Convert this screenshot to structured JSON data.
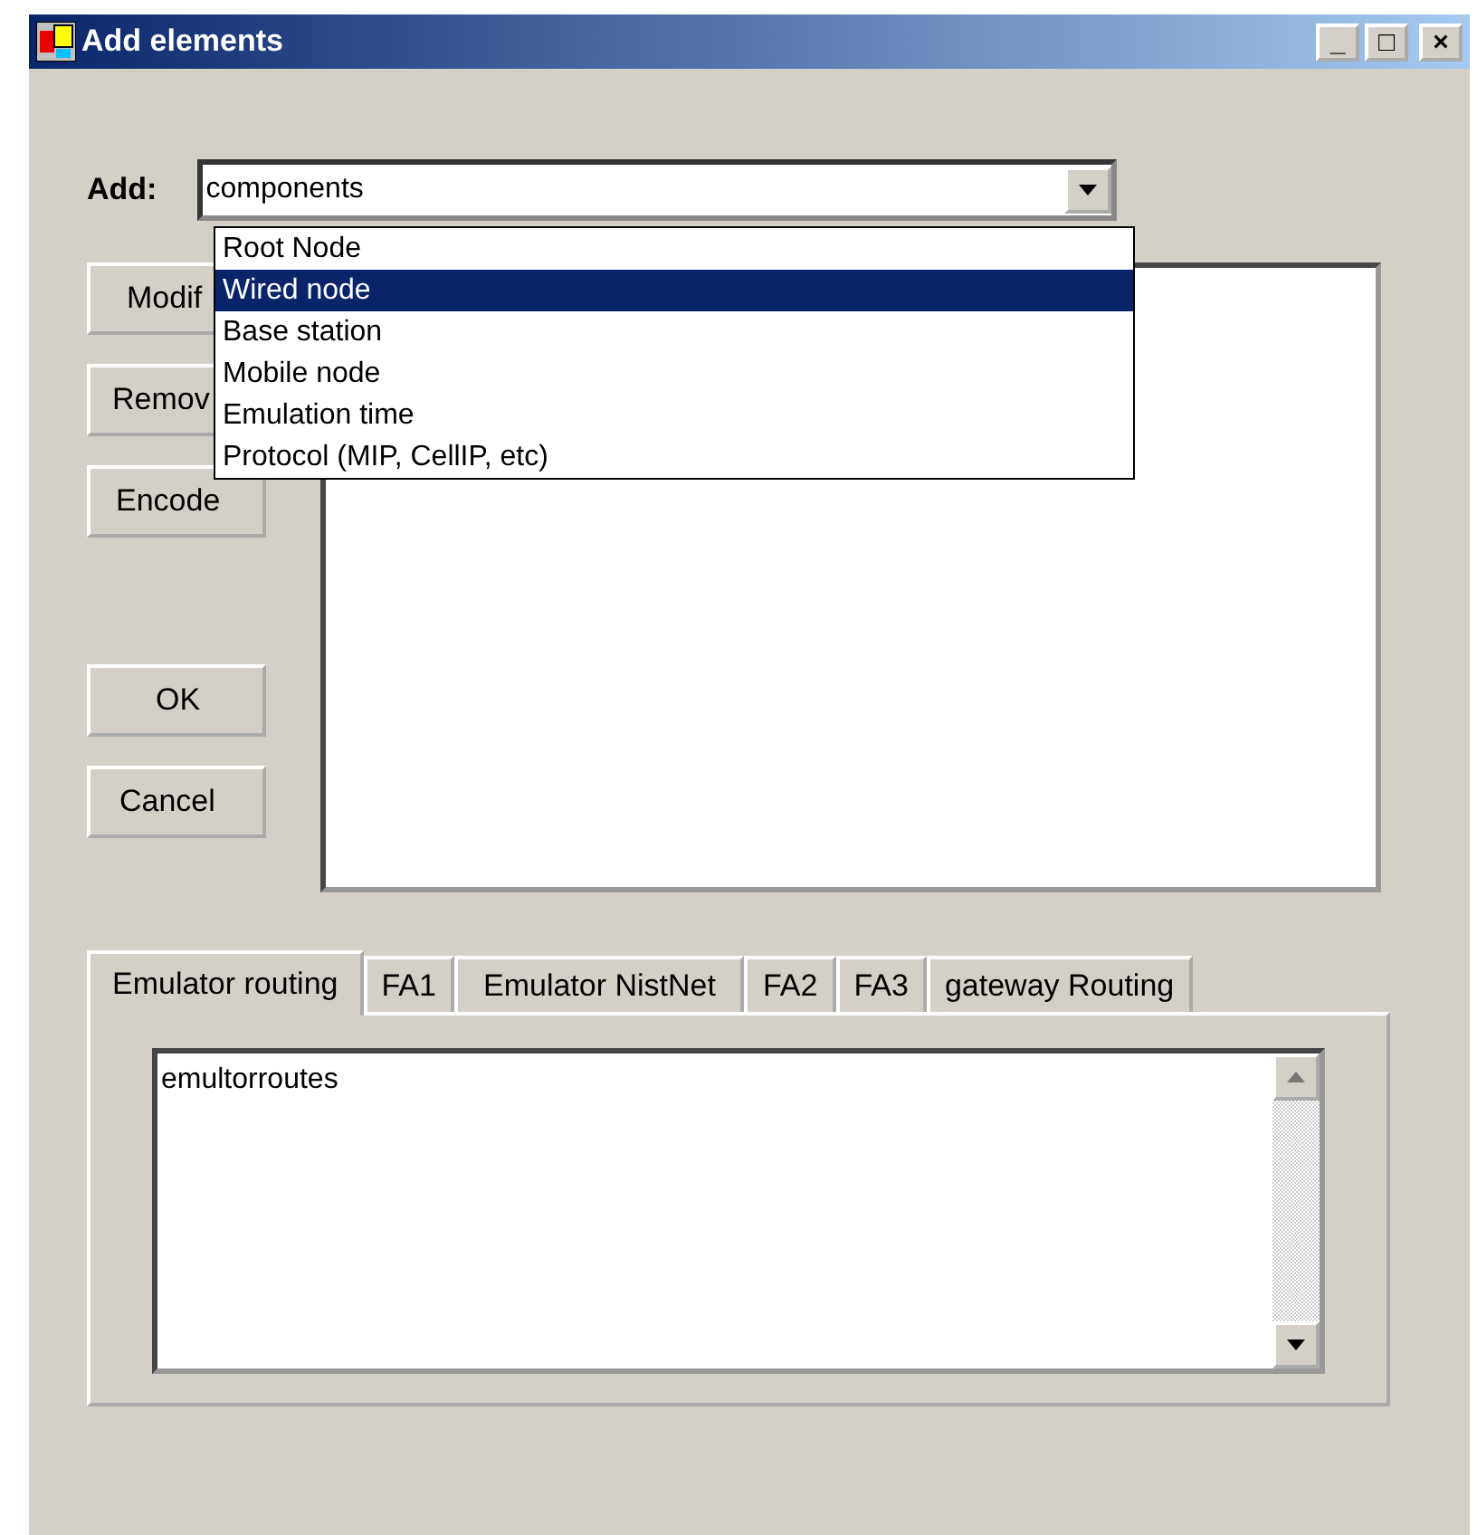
{
  "window": {
    "title": "Add elements",
    "controls": [
      "_",
      "□",
      "×"
    ]
  },
  "add": {
    "label": "Add:",
    "value": "components",
    "expanded": true,
    "options": [
      {
        "label": "Root Node",
        "selected": false
      },
      {
        "label": "Wired node",
        "selected": true
      },
      {
        "label": "Base station",
        "selected": false
      },
      {
        "label": "Mobile node",
        "selected": false
      },
      {
        "label": "Emulation time",
        "selected": false
      },
      {
        "label": "Protocol (MIP, CellIP, etc)",
        "selected": false
      }
    ]
  },
  "buttons": [
    "Modif",
    "Remov",
    "Encode",
    "OK",
    "Cancel"
  ],
  "tabs": [
    {
      "label": "Emulator routing",
      "selected": true
    },
    {
      "label": "FA1",
      "selected": false
    },
    {
      "label": "Emulator NistNet",
      "selected": false
    },
    {
      "label": "FA2",
      "selected": false
    },
    {
      "label": "FA3",
      "selected": false
    },
    {
      "label": "gateway Routing",
      "selected": false
    }
  ],
  "tab_content": {
    "text": "emultorroutes"
  }
}
